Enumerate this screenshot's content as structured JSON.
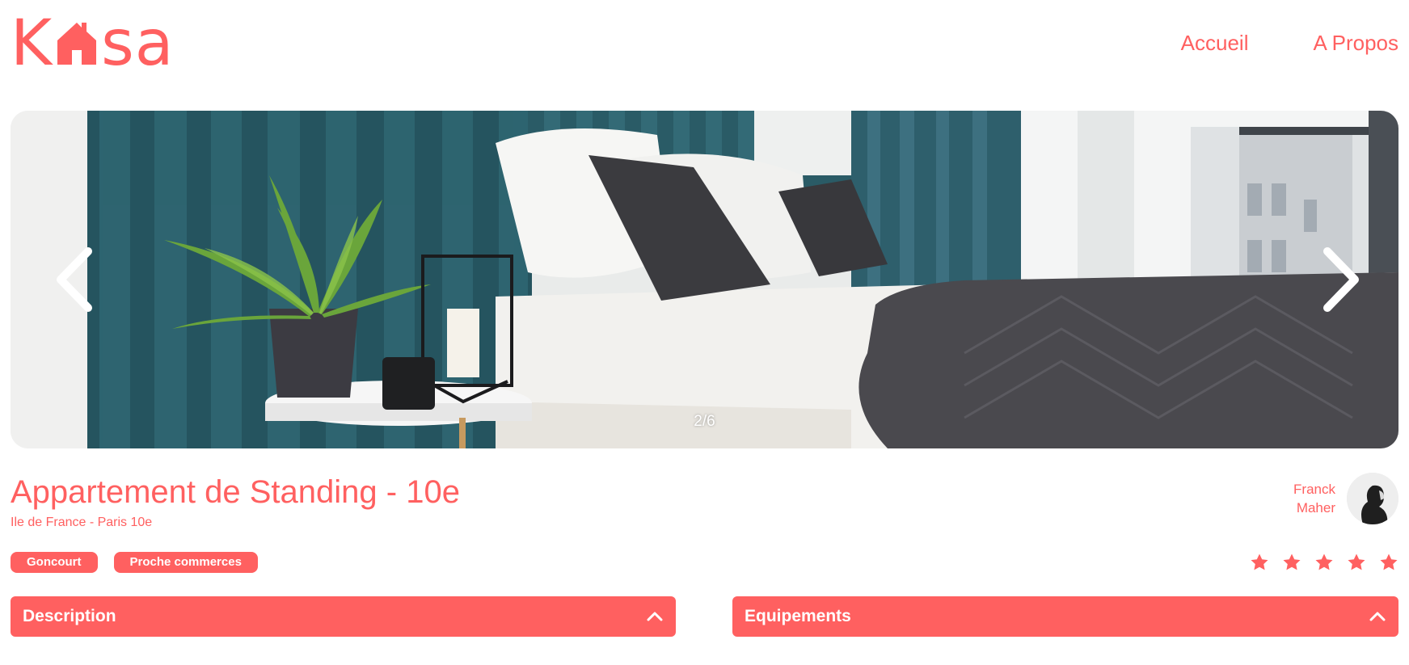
{
  "brand": {
    "logo_left": "K",
    "logo_right": "sa",
    "accent_color": "#FF6060"
  },
  "nav": {
    "items": [
      {
        "label": "Accueil"
      },
      {
        "label": "A Propos"
      }
    ]
  },
  "gallery": {
    "counter": "2/6",
    "current_index": 2,
    "total": 6,
    "prev_icon": "chevron-left-icon",
    "next_icon": "chevron-right-icon"
  },
  "listing": {
    "title": "Appartement de Standing - 10e",
    "location": "Ile de France - Paris 10e",
    "tags": [
      "Goncourt",
      "Proche commerces"
    ],
    "rating": 5,
    "rating_max": 5,
    "star_color": "#FF6060"
  },
  "host": {
    "first_name": "Franck",
    "last_name": "Maher"
  },
  "sections": {
    "description_label": "Description",
    "equipments_label": "Equipements",
    "toggle_icon": "chevron-up-icon"
  }
}
